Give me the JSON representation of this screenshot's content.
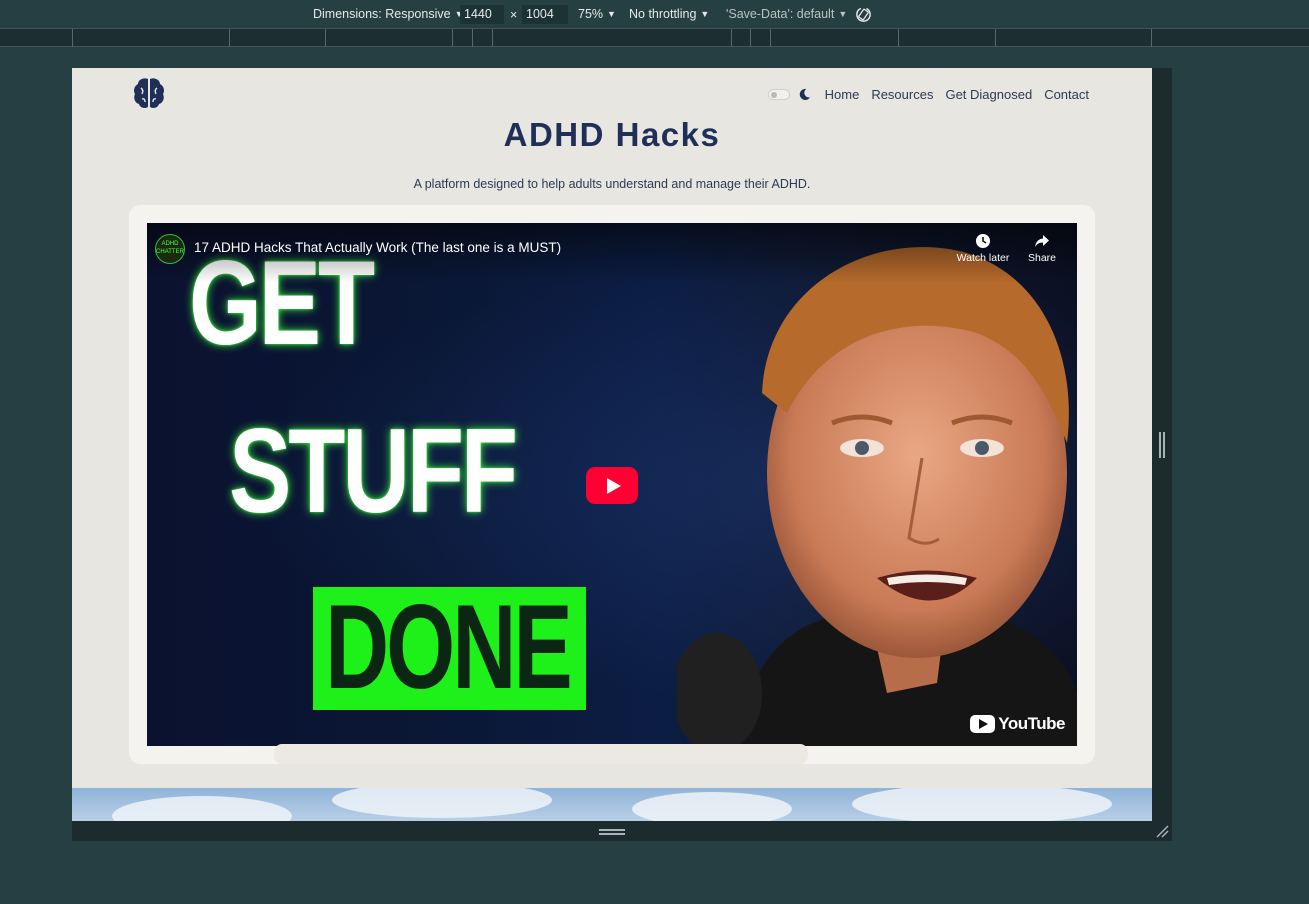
{
  "devtools": {
    "dimensions_label": "Dimensions: Responsive",
    "width": "1440",
    "times": "×",
    "height": "1004",
    "zoom": "75%",
    "throttling": "No throttling",
    "save_data": "'Save-Data': default"
  },
  "site": {
    "nav": {
      "home": "Home",
      "resources": "Resources",
      "diagnosed": "Get Diagnosed",
      "contact": "Contact"
    },
    "title": "ADHD Hacks",
    "subtitle": "A platform designed to help adults understand and manage their ADHD."
  },
  "video": {
    "title": "17 ADHD Hacks That Actually Work (The last one is a MUST)",
    "channel_avatar_text": "ADHD CHATTER",
    "watch_later": "Watch later",
    "share": "Share",
    "thumb_line1": "GET",
    "thumb_line2": "STUFF",
    "thumb_line3": "DONE",
    "platform": "YouTube"
  },
  "colors": {
    "page_bg": "#e8e6e1",
    "title": "#1f2f58",
    "accent_green": "#1ef01a",
    "play_red": "#ff0033"
  }
}
